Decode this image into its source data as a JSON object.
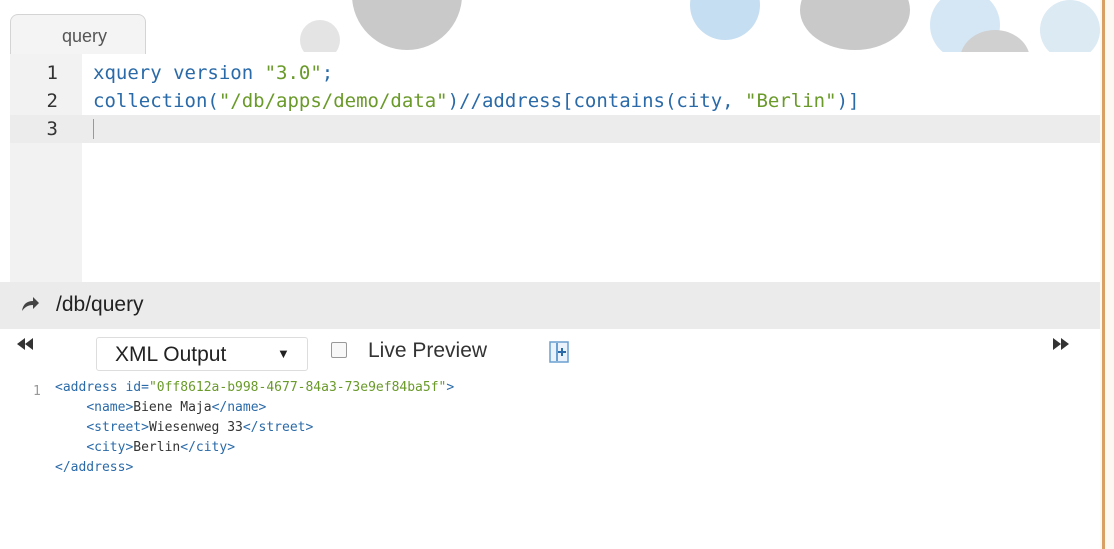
{
  "tab": {
    "label": "query"
  },
  "editor": {
    "lines": [
      {
        "number": "1",
        "parts": [
          {
            "text": "xquery version ",
            "type": "kw"
          },
          {
            "text": "\"3.0\"",
            "type": "str"
          },
          {
            "text": ";",
            "type": "kw"
          }
        ]
      },
      {
        "number": "2",
        "parts": [
          {
            "text": "collection(",
            "type": "kw"
          },
          {
            "text": "\"/db/apps/demo/data\"",
            "type": "str"
          },
          {
            "text": ")//address[contains(city, ",
            "type": "kw"
          },
          {
            "text": "\"Berlin\"",
            "type": "str"
          },
          {
            "text": ")]",
            "type": "kw"
          }
        ]
      },
      {
        "number": "3",
        "parts": []
      }
    ]
  },
  "path_bar": {
    "path": "/db/query",
    "icon": "share-arrow-icon"
  },
  "toolbar": {
    "output_select": {
      "value": "XML Output"
    },
    "live_preview": {
      "label": "Live Preview",
      "checked": false
    },
    "icons": {
      "left": "rewind-icon",
      "right": "fast-forward-icon",
      "expand": "expand-panel-icon"
    }
  },
  "output": {
    "line_number": "1",
    "lines": [
      {
        "indent": "",
        "tag_open": "<address",
        "attr": " id=",
        "value": "\"0ff8612a-b998-4677-84a3-73e9ef84ba5f\"",
        "tag_close": ">"
      },
      {
        "indent": "    ",
        "open": "<name>",
        "text": "Biene Maja",
        "close": "</name>"
      },
      {
        "indent": "    ",
        "open": "<street>",
        "text": "Wiesenweg 33",
        "close": "</street>"
      },
      {
        "indent": "    ",
        "open": "<city>",
        "text": "Berlin",
        "close": "</city>"
      },
      {
        "indent": "",
        "open": "</address>",
        "text": "",
        "close": ""
      }
    ]
  },
  "colors": {
    "keyword": "#2a6aa8",
    "string": "#6a9a2a",
    "accent_border": "#d9a066"
  }
}
